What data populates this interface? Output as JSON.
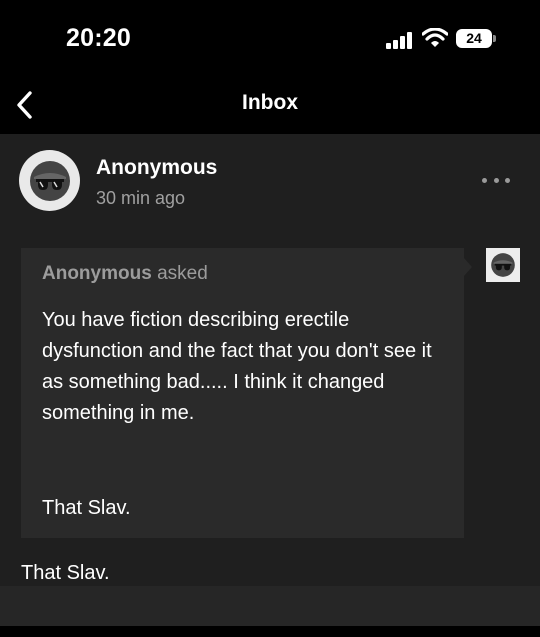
{
  "status_bar": {
    "time": "20:20",
    "battery": "24",
    "icons": [
      "signal-icon",
      "wifi-icon",
      "battery-icon"
    ]
  },
  "nav": {
    "title": "Inbox",
    "back_icon": "chevron-left-icon"
  },
  "post": {
    "author": "Anonymous",
    "time_ago": "30 min ago",
    "avatar_icon": "anonymous-sunglasses-icon",
    "more_icon": "ellipsis-icon"
  },
  "ask": {
    "asker": "Anonymous",
    "asked_label": "asked",
    "body": "You have fiction describing erectile dysfunction and the fact that you don't see it as something bad..... I think it changed something in me.",
    "signature": "That Slav."
  },
  "reply": {
    "text": "That Slav."
  },
  "colors": {
    "background": "#000000",
    "content_bg": "#1f1f1f",
    "card_bg": "#2a2a2a",
    "muted_text": "#9c9c9c"
  }
}
